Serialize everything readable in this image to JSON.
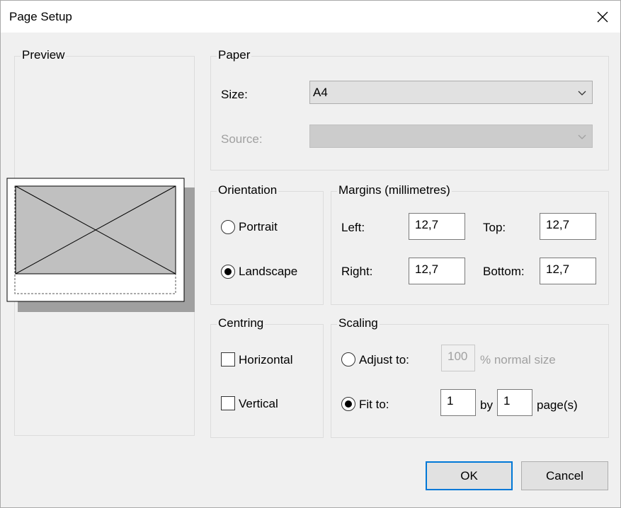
{
  "window": {
    "title": "Page Setup"
  },
  "preview": {
    "label": "Preview"
  },
  "paper": {
    "label": "Paper",
    "size_label": "Size:",
    "size_value": "A4",
    "source_label": "Source:",
    "source_value": ""
  },
  "orientation": {
    "label": "Orientation",
    "portrait": "Portrait",
    "landscape": "Landscape",
    "selected": "landscape"
  },
  "margins": {
    "label": "Margins (millimetres)",
    "left_label": "Left:",
    "left_value": "12,7",
    "top_label": "Top:",
    "top_value": "12,7",
    "right_label": "Right:",
    "right_value": "12,7",
    "bottom_label": "Bottom:",
    "bottom_value": "12,7"
  },
  "centring": {
    "label": "Centring",
    "horizontal": "Horizontal",
    "vertical": "Vertical"
  },
  "scaling": {
    "label": "Scaling",
    "adjust_label": "Adjust to:",
    "adjust_value": "100",
    "adjust_suffix": "% normal size",
    "fit_label": "Fit to:",
    "fit_wide": "1",
    "by_label": "by",
    "fit_tall": "1",
    "pages_label": "page(s)",
    "selected": "fit"
  },
  "buttons": {
    "ok": "OK",
    "cancel": "Cancel"
  },
  "colors": {
    "accent": "#0078d7",
    "paper_fill": "#c0c0c0",
    "shadow": "#a0a0a0"
  }
}
